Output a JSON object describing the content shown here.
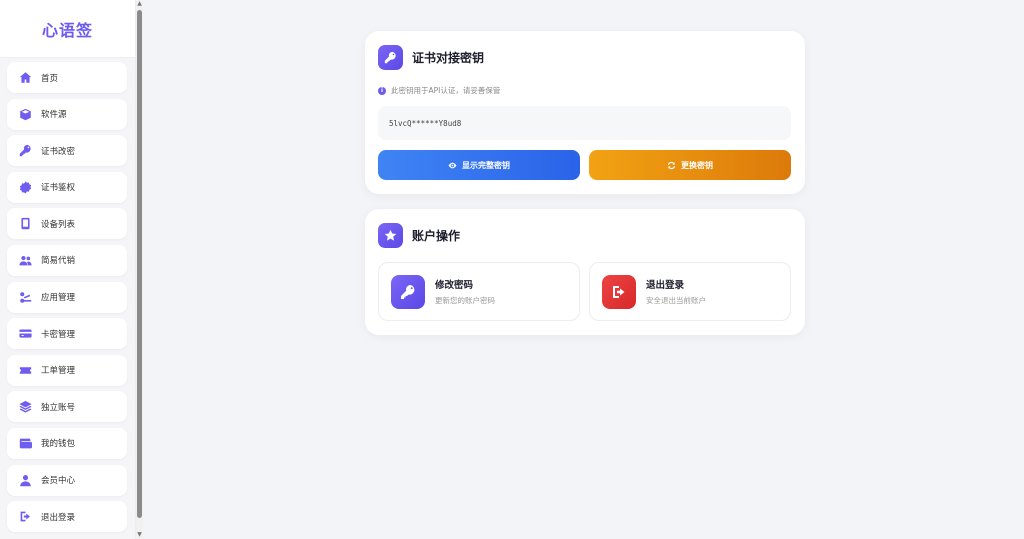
{
  "brand": "心语签",
  "menu": [
    {
      "label": "首页",
      "icon": "home-icon"
    },
    {
      "label": "软件源",
      "icon": "box-icon"
    },
    {
      "label": "证书改密",
      "icon": "key-icon"
    },
    {
      "label": "证书鉴权",
      "icon": "badge-icon"
    },
    {
      "label": "设备列表",
      "icon": "mobile-icon"
    },
    {
      "label": "简易代销",
      "icon": "users-icon"
    },
    {
      "label": "应用管理",
      "icon": "app-manage-icon"
    },
    {
      "label": "卡密管理",
      "icon": "card-icon"
    },
    {
      "label": "工单管理",
      "icon": "ticket-icon"
    },
    {
      "label": "独立账号",
      "icon": "layers-icon"
    },
    {
      "label": "我的钱包",
      "icon": "wallet-icon"
    },
    {
      "label": "会员中心",
      "icon": "user-icon"
    },
    {
      "label": "退出登录",
      "icon": "logout-icon"
    }
  ],
  "key_card": {
    "title": "证书对接密钥",
    "hint": "此密钥用于API认证，请妥善保管",
    "key_value": "5lvcQ******Y8ud8",
    "show_button": "显示完整密钥",
    "change_button": "更换密钥"
  },
  "account_card": {
    "title": "账户操作",
    "change_password": {
      "title": "修改密码",
      "subtitle": "更新您的账户密码"
    },
    "logout": {
      "title": "退出登录",
      "subtitle": "安全退出当前账户"
    }
  },
  "colors": {
    "accent": "#6d5bf0",
    "show_button": "#3070ee",
    "change_button": "#e88d0f",
    "logout_icon_bg": "#e53535"
  }
}
